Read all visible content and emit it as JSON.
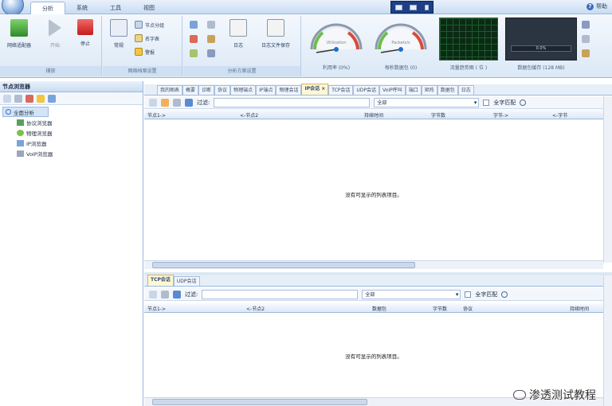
{
  "menu": {
    "tabs": [
      "分析",
      "系统",
      "工具",
      "视图"
    ],
    "help": "帮助"
  },
  "ribbon": {
    "adapter_group": {
      "buttons": [
        "网络适配器",
        "开始",
        "停止"
      ],
      "caption": "捕获"
    },
    "profile_group": {
      "big_button": "常规",
      "smalls": [
        "节点分组",
        "名字表",
        "警报"
      ],
      "caption": "网络档案设置"
    },
    "analysis_group": {
      "buttons": [
        "日志",
        "日志文件保存"
      ],
      "caption": "分析方案设置"
    },
    "gauges": [
      {
        "label": "利用率 (0%)",
        "inner": "Utilization"
      },
      {
        "label": "每秒数据包 (0)",
        "inner": "Packets/s"
      }
    ],
    "traffic_label": "流量趋势图 ( 位 )",
    "buffer": {
      "label": "数据包缓存 (128 MB)",
      "value": "0.0%"
    }
  },
  "left": {
    "title": "节点浏览器",
    "root": "全面分析",
    "children": [
      "协议浏览器",
      "物理浏览器",
      "IP浏览器",
      "VoIP浏览器"
    ]
  },
  "top_view": {
    "tabs": [
      "我的图表",
      "概要",
      "诊断",
      "协议",
      "物理端点",
      "IP端点",
      "物理会话",
      "IP会话",
      "TCP会话",
      "UDP会话",
      "VoIP呼叫",
      "端口",
      "矩阵",
      "数据包",
      "日志"
    ],
    "active_tab": "IP会话",
    "filter_label": "过滤:",
    "combo_value": "全部",
    "match_label": "全字匹配",
    "columns": [
      "节点1->",
      "<-节点2",
      "持续时间",
      "字节数",
      "字节->",
      "<-字节"
    ],
    "empty_text": "没有可显示的列表项目。"
  },
  "bottom_view": {
    "tabs": [
      "TCP会话",
      "UDP会话"
    ],
    "active_tab": "TCP会话",
    "filter_label": "过滤:",
    "combo_value": "全部",
    "match_label": "全字匹配",
    "columns": [
      "节点1->",
      "<-节点2",
      "数据包",
      "字节数",
      "协议",
      "持续时间"
    ],
    "empty_text": "没有可显示的列表项目。"
  },
  "watermark": "渗透测试教程"
}
